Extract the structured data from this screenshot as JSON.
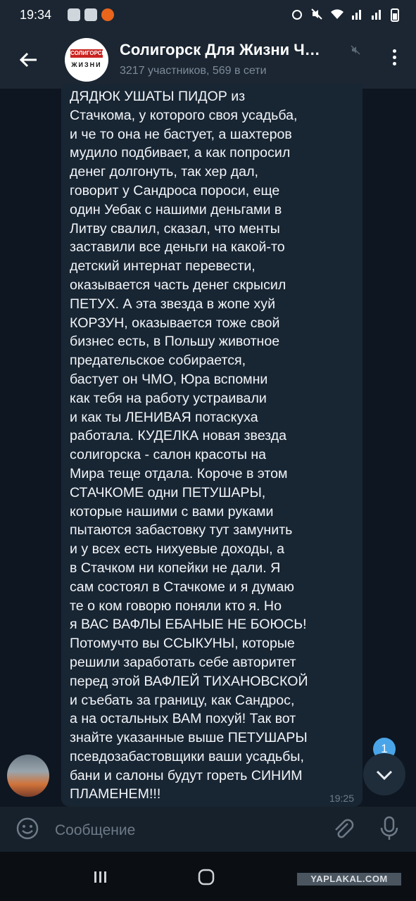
{
  "status_bar": {
    "time": "19:34"
  },
  "header": {
    "avatar_top": "СОЛИГОРСК",
    "avatar_bottom": "ЖИЗНИ",
    "title": "Солигорск Для Жизни Ч…",
    "subtitle": "3217 участников, 569 в сети"
  },
  "message": {
    "text": "ДЯДЮК УШАТЫ ПИДОР из\nСтачкома, у которого своя усадьба,\nи че то она не бастует, а шахтеров\nмудило подбивает, а как попросил\nденег долгонуть, так хер дал,\nговорит у Сандроса пороси, еще\nодин Уебак с нашими деньгами в\nЛитву свалил, сказал, что менты\nзаставили все деньги на какой-то\nдетский интернат перевести,\nоказывается часть денег скрысил\nПЕТУХ. А эта звезда в жопе хуй\nКОРЗУН, оказывается тоже свой\nбизнес есть, в Польшу животное\nпредательское собирается,\nбастует он ЧМО, Юра вспомни\nкак тебя на работу устраивали\nи как ты ЛЕНИВАЯ потаскуха\nработала. КУДЕЛКА новая звезда\nсолигорска - салон красоты на\nМира теще отдала. Короче в этом\nСТАЧКОМЕ одни ПЕТУШАРЫ,\nкоторые нашими с вами руками\nпытаются забастовку тут замунить\nи у всех есть нихуевые доходы, а\nв Стачком ни копейки не дали. Я\nсам состоял в Стачкоме и я думаю\nте о ком говорю поняли кто я. Но\nя ВАС ВАФЛЫ ЕБАНЫЕ НЕ БОЮСЬ!\nПотомучто вы ССЫКУНЫ, которые\nрешили заработать себе авторитет\nперед этой ВАФЛЕЙ ТИХАНОВСКОЙ\nи съебать за границу, как Сандрос,\nа на остальных ВАМ похуй! Так вот\nзнайте указанные выше ПЕТУШАРЫ\nпсевдозабастовщики ваши усадьбы,\nбани и салоны будут гореть СИНИМ\nПЛАМЕНЕМ!!!",
    "time": "19:25"
  },
  "scroll": {
    "unread_count": "1"
  },
  "input": {
    "placeholder": "Сообщение"
  },
  "watermark": "YAPLAKAL.COM",
  "colors": {
    "background": "#0e1621",
    "header": "#1b2632",
    "bubble": "#182533",
    "accent": "#4aa5e8"
  }
}
